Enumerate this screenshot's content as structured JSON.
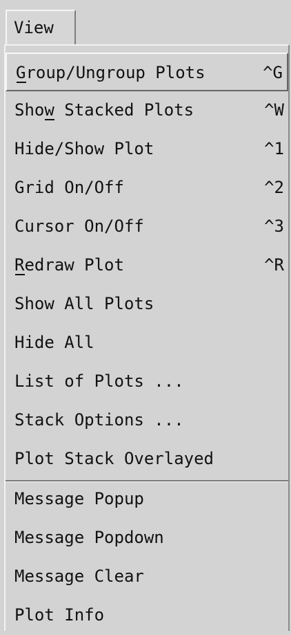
{
  "menubar": {
    "view_label": "View"
  },
  "menu": {
    "items": [
      {
        "label": "Group/Ungroup Plots",
        "accel": "^G"
      },
      {
        "label": "Show Stacked Plots",
        "accel": "^W"
      },
      {
        "label": "Hide/Show Plot",
        "accel": "^1"
      },
      {
        "label": "Grid On/Off",
        "accel": "^2"
      },
      {
        "label": "Cursor On/Off",
        "accel": "^3"
      },
      {
        "label": "Redraw Plot",
        "accel": "^R"
      },
      {
        "label": "Show All Plots",
        "accel": ""
      },
      {
        "label": "Hide All",
        "accel": ""
      },
      {
        "label": "List of Plots ...",
        "accel": ""
      },
      {
        "label": "Stack Options ...",
        "accel": ""
      },
      {
        "label": "Plot Stack Overlayed",
        "accel": ""
      },
      {
        "label": "Message Popup",
        "accel": ""
      },
      {
        "label": "Message Popdown",
        "accel": ""
      },
      {
        "label": "Message Clear",
        "accel": ""
      },
      {
        "label": "Plot Info",
        "accel": ""
      }
    ]
  },
  "colors": {
    "background": "#d3d3d3",
    "text": "#111111",
    "highlight": "#f7f7f7",
    "shadow": "#666666"
  }
}
